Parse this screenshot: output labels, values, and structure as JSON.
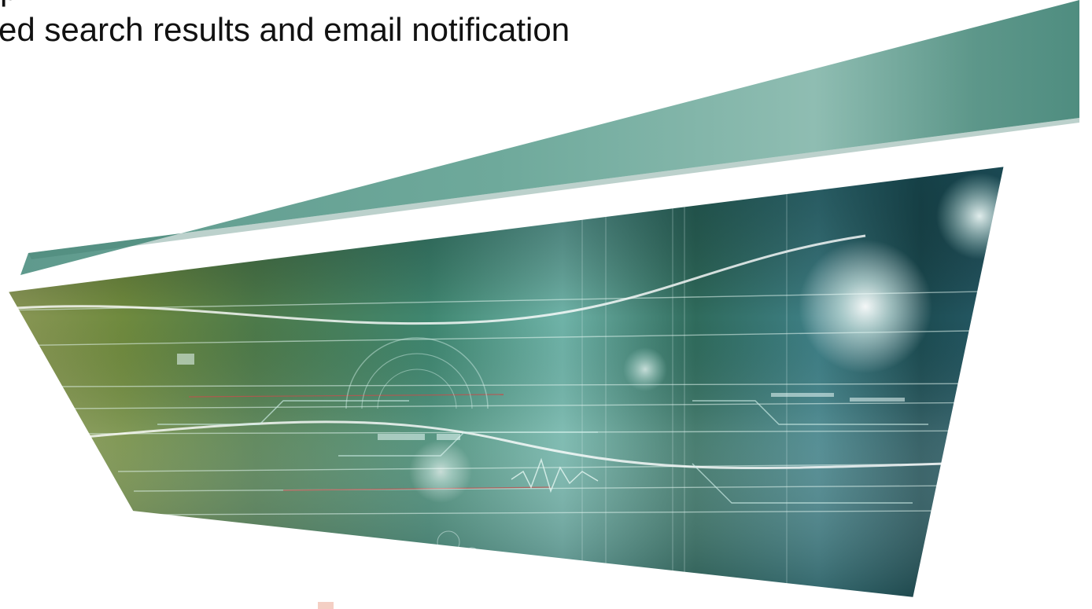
{
  "slide": {
    "title_top_fragment": "p",
    "title_line": "ed search results and email notification"
  },
  "graphic": {
    "banner_color": "#4f8d80",
    "banner_highlight": "#8fbdb2",
    "panel_colors": [
      "#6f8a3e",
      "#2f6b5c",
      "#dff2f0",
      "#1c4c52"
    ],
    "accent_line_color": "#c0504d",
    "footer_mark_color": "#f4cfc4"
  }
}
